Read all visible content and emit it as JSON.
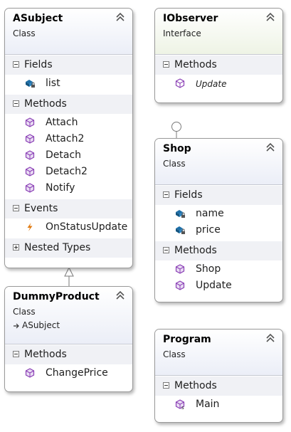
{
  "colors": {
    "method_icon": "#8a3fb5",
    "field_icon": "#1e6fa8",
    "event_icon": "#e07a10",
    "border": "#9a9a9a"
  },
  "asubject": {
    "name": "ASubject",
    "kind": "Class",
    "fields_label": "Fields",
    "fields": [
      "list"
    ],
    "methods_label": "Methods",
    "methods": [
      "Attach",
      "Attach2",
      "Detach",
      "Detach2",
      "Notify"
    ],
    "events_label": "Events",
    "events": [
      "OnStatusUpdate"
    ],
    "nested_label": "Nested Types"
  },
  "iobserver": {
    "name": "IObserver",
    "kind": "Interface",
    "methods_label": "Methods",
    "methods": [
      "Update"
    ]
  },
  "shop": {
    "name": "Shop",
    "kind": "Class",
    "fields_label": "Fields",
    "fields": [
      "name",
      "price"
    ],
    "methods_label": "Methods",
    "methods": [
      "Shop",
      "Update"
    ]
  },
  "dummyproduct": {
    "name": "DummyProduct",
    "kind": "Class",
    "base": "ASubject",
    "methods_label": "Methods",
    "methods": [
      "ChangePrice"
    ]
  },
  "program": {
    "name": "Program",
    "kind": "Class",
    "methods_label": "Methods",
    "methods": [
      "Main"
    ]
  }
}
